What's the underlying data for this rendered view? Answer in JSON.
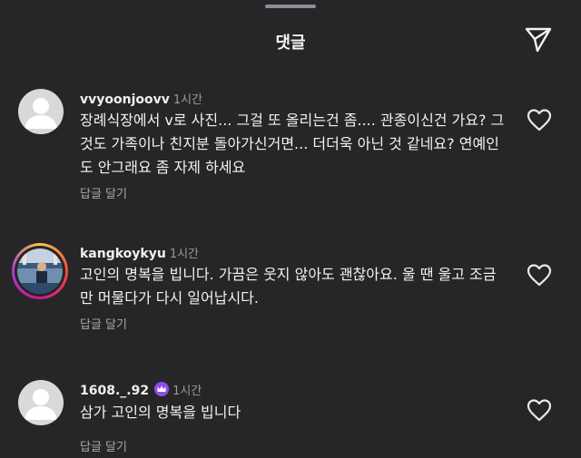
{
  "header": {
    "title": "댓글"
  },
  "comments": [
    {
      "username": "vvyoonjoovv",
      "time": "1시간",
      "text": "장례식장에서 v로 사진... 그걸 또 올리는건 좀.... 관종이신건 가요? 그것도 가족이나 친지분 돌아가신거면... 더더욱 아닌 것 같네요? 연예인도 안그래요 좀 자제 하세요",
      "reply_label": "답글 달기",
      "avatar": "default-avatar"
    },
    {
      "username": "kangkoykyu",
      "time": "1시간",
      "text": "고인의 명복을 빕니다. 가끔은 웃지 않아도 괜찮아요. 울 땐 울고 조금만 머물다가 다시 일어납시다.",
      "reply_label": "답글 달기",
      "avatar": "photo-avatar-with-story-ring"
    },
    {
      "username": "1608._.92",
      "time": "1시간",
      "text": "삼가 고인의 명복을 빕니다",
      "reply_label": "답글 달기",
      "avatar": "default-avatar",
      "badge": "crown-badge"
    }
  ],
  "colors": {
    "background": "#262628",
    "secondary_text": "#a8a8a8",
    "badge": "#8f4cf0"
  }
}
